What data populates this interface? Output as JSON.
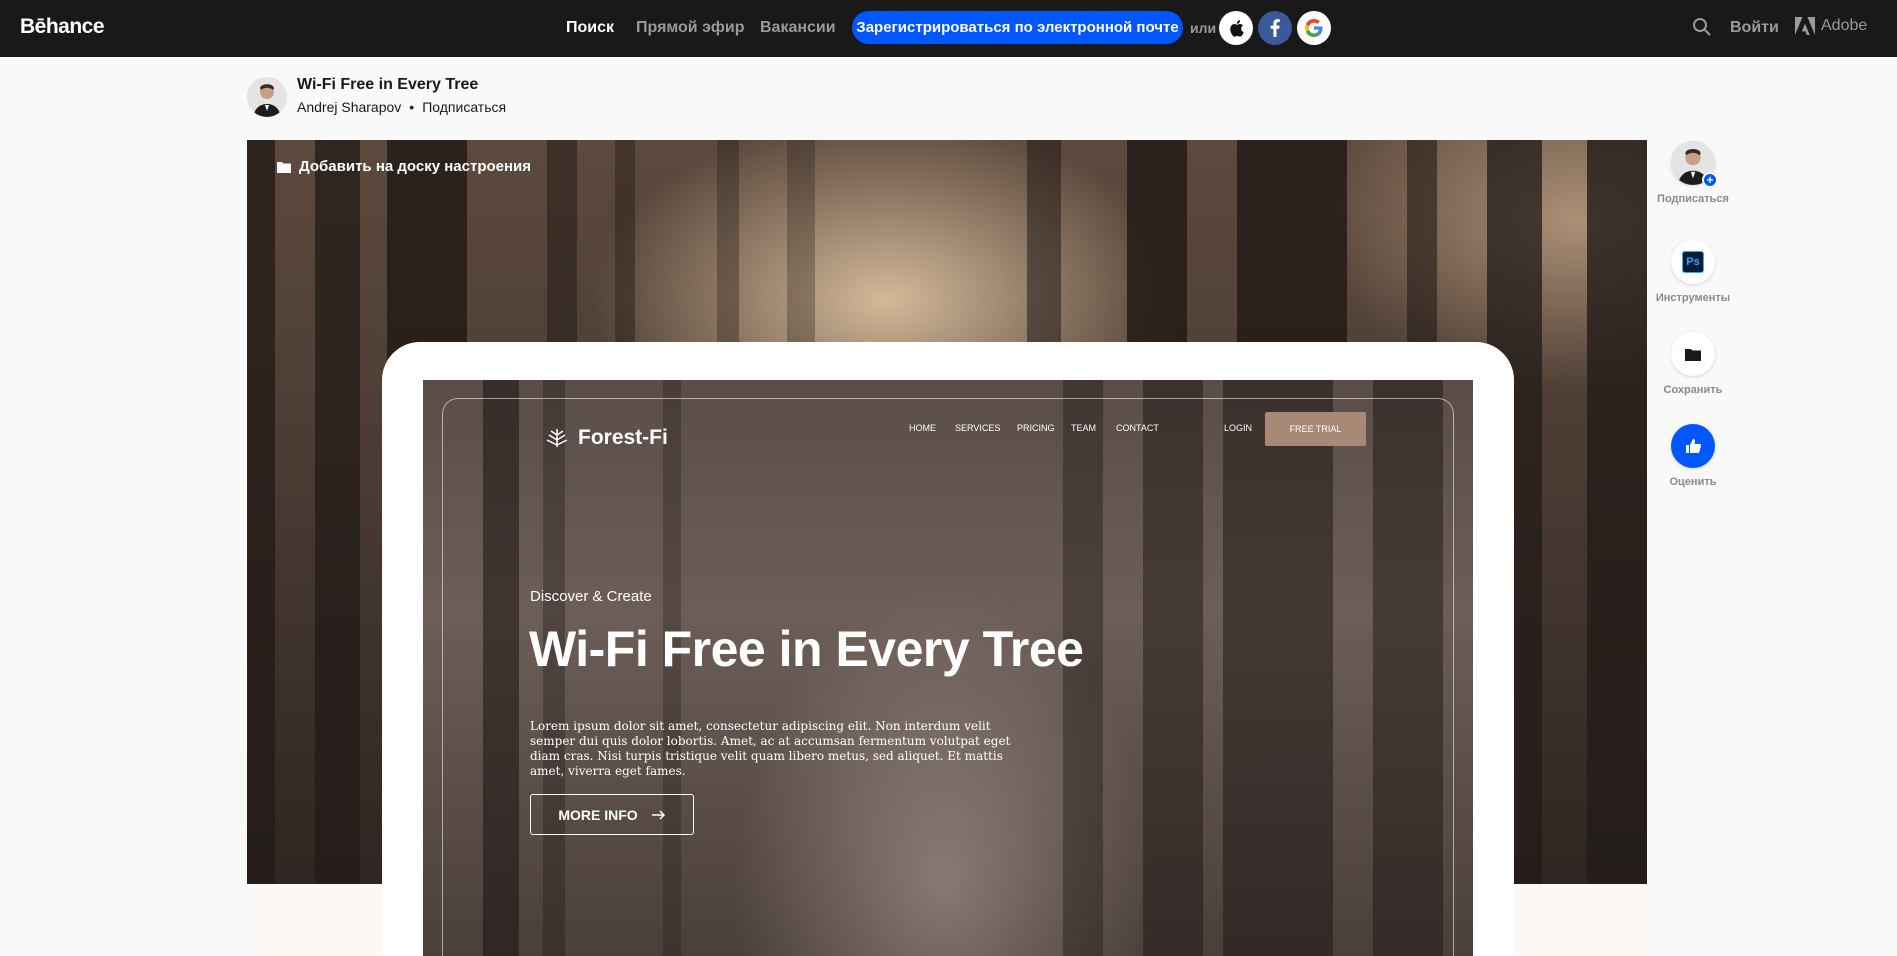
{
  "topbar": {
    "logo": "Bēhance",
    "nav": [
      "Поиск",
      "Прямой эфир",
      "Вакансии"
    ],
    "signup_label": "Зарегистрироваться по электронной почте",
    "or_label": "или",
    "login_label": "Войти",
    "adobe_label": "Adobe"
  },
  "project": {
    "title": "Wi-Fi Free in Every Tree",
    "owner": "Andrej Sharapov",
    "follow_label": "Подписаться",
    "moodboard_label": "Добавить на доску настроения"
  },
  "mockup": {
    "logo_text": "Forest-Fi",
    "nav": [
      "HOME",
      "SERVICES",
      "PRICING",
      "TEAM",
      "CONTACT"
    ],
    "login": "LOGIN",
    "trial": "FREE TRIAL",
    "subtitle": "Discover & Create",
    "headline": "Wi-Fi Free in Every Tree",
    "body": "Lorem ipsum dolor sit amet, consectetur adipiscing elit. Non interdum velit semper dui quis dolor lobortis. Amet, ac at accumsan fermentum volutpat eget diam cras. Nisi turpis tristique velit quam libero metus, sed aliquet. Et mattis amet, viverra eget fames.",
    "button": "MORE INFO"
  },
  "rail": {
    "follow": "Подписаться",
    "tools": "Инструменты",
    "tool_badge": "Ps",
    "save": "Сохранить",
    "appreciate": "Оценить"
  },
  "colors": {
    "topbar_bg": "#191919",
    "accent": "#0057ff",
    "trial_btn": "#a78976"
  }
}
